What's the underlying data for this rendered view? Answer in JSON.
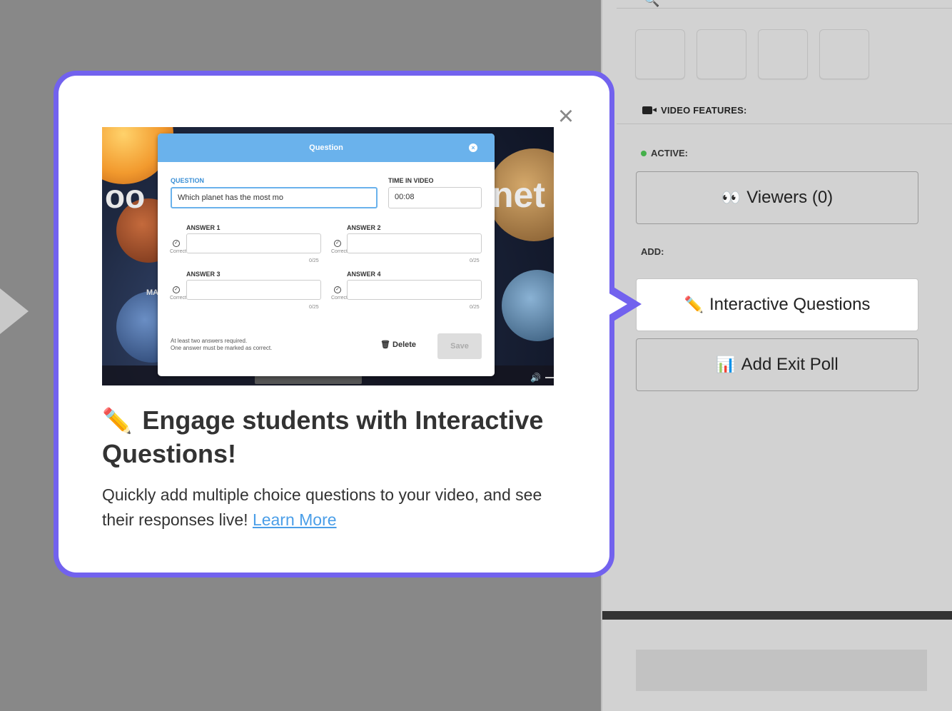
{
  "background": {
    "play_icon": "play-triangle-icon"
  },
  "panel": {
    "top_glyph": "🔍",
    "section_title": "VIDEO FEATURES:",
    "section_icon": "video-camera-icon",
    "active_label": "ACTIVE:",
    "add_label": "ADD:",
    "viewers_button": {
      "emoji": "👀",
      "label": "Viewers (0)"
    },
    "interactive_questions_button": {
      "emoji": "✏️",
      "label": "Interactive Questions"
    },
    "exit_poll_button": {
      "emoji": "📊",
      "label": "Add Exit Poll"
    }
  },
  "popup": {
    "close_icon": "close-icon",
    "title_emoji": "✏️",
    "title": "Engage students with Interactive Questions!",
    "body": "Quickly add multiple choice questions to your video, and see their responses live!",
    "link": "Learn More",
    "screenshot": {
      "bg_left_text": "oo",
      "bg_right_text": "net",
      "bg_small_text": "MA",
      "modal_title": "Question",
      "question_label": "QUESTION",
      "question_value": "Which planet has the most mo",
      "time_label": "TIME IN VIDEO",
      "time_value": "00:08",
      "answers": [
        {
          "label": "ANSWER 1",
          "count": "0/25"
        },
        {
          "label": "ANSWER 2",
          "count": "0/25"
        },
        {
          "label": "ANSWER 3",
          "count": "0/25"
        },
        {
          "label": "ANSWER 4",
          "count": "0/25"
        }
      ],
      "correct_label": "Correct",
      "note_line1": "At least two answers required.",
      "note_line2": "One answer must be marked as correct.",
      "delete_label": "Delete",
      "save_label": "Save"
    }
  },
  "colors": {
    "popup_border": "#7262ee",
    "link": "#4a9ee8",
    "modal_header": "#6ab2ec",
    "active_dot": "#45b04b",
    "overlay": "#888888",
    "panel": "#d2d2d2"
  }
}
